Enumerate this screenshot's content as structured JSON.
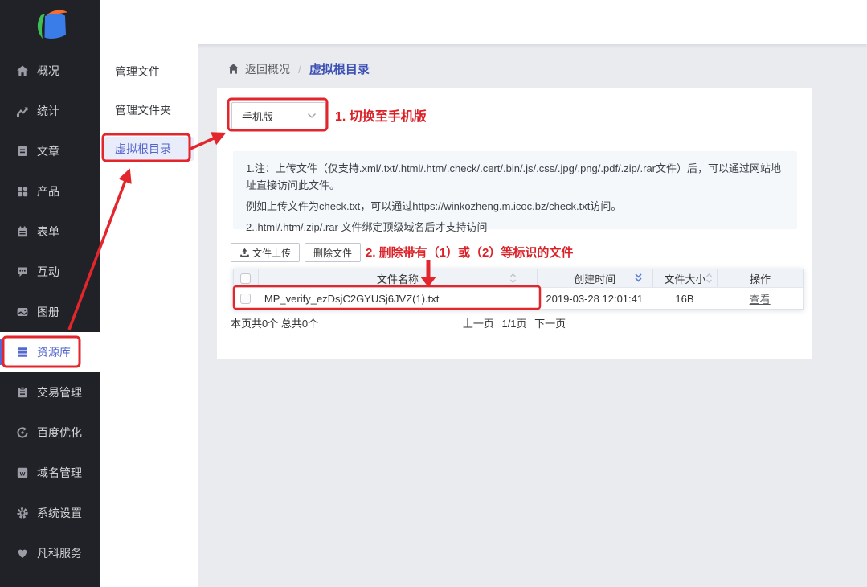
{
  "colors": {
    "annotation_red": "#e2262c",
    "sidebar_bg": "#212227",
    "accent_blue": "#5265cc",
    "breadcrumb_active_blue": "#3c50b4",
    "note_bg": "#f4f8fb"
  },
  "sidebar": {
    "items": [
      {
        "label": "概况",
        "icon": "home-icon"
      },
      {
        "label": "统计",
        "icon": "stats-icon"
      },
      {
        "label": "文章",
        "icon": "article-icon"
      },
      {
        "label": "产品",
        "icon": "products-icon"
      },
      {
        "label": "表单",
        "icon": "form-icon"
      },
      {
        "label": "互动",
        "icon": "chat-icon"
      },
      {
        "label": "图册",
        "icon": "gallery-icon"
      },
      {
        "label": "资源库",
        "icon": "database-icon",
        "active": true
      },
      {
        "label": "交易管理",
        "icon": "trade-icon"
      },
      {
        "label": "百度优化",
        "icon": "seo-icon"
      },
      {
        "label": "域名管理",
        "icon": "domain-icon"
      },
      {
        "label": "系统设置",
        "icon": "gear-icon"
      },
      {
        "label": "凡科服务",
        "icon": "heart-icon"
      }
    ]
  },
  "subnav": {
    "items": [
      {
        "label": "管理文件"
      },
      {
        "label": "管理文件夹"
      },
      {
        "label": "虚拟根目录",
        "active": true
      }
    ]
  },
  "breadcrumb": {
    "back_label": "返回概况",
    "separator": "/",
    "current": "虚拟根目录"
  },
  "content": {
    "version_select": {
      "value": "手机版"
    },
    "notes": {
      "line1": "1.注：上传文件（仅支持.xml/.txt/.html/.htm/.check/.cert/.bin/.js/.css/.jpg/.png/.pdf/.zip/.rar文件）后，可以通过网站地址直接访问此文件。",
      "line2": "例如上传文件为check.txt，可以通过https://winkozheng.m.icoc.bz/check.txt访问。",
      "line3": "2..html/.htm/.zip/.rar 文件绑定顶级域名后才支持访问"
    },
    "toolbar": {
      "upload_label": "文件上传",
      "delete_label": "删除文件"
    },
    "table": {
      "headers": {
        "name": "文件名称",
        "created": "创建时间",
        "size": "文件大小",
        "action": "操作"
      },
      "rows": [
        {
          "name": "MP_verify_ezDsjC2GYUSj6JVZ(1).txt",
          "created": "2019-03-28 12:01:41",
          "size": "16B",
          "action_label": "查看"
        }
      ]
    },
    "pagination": {
      "summary": "本页共0个 总共0个",
      "prev_label": "上一页",
      "page_label": "1/1页",
      "next_label": "下一页"
    }
  },
  "annotations": {
    "step1_label": "1. 切换至手机版",
    "step2_label": "2. 删除带有（1）或（2）等标识的文件"
  }
}
